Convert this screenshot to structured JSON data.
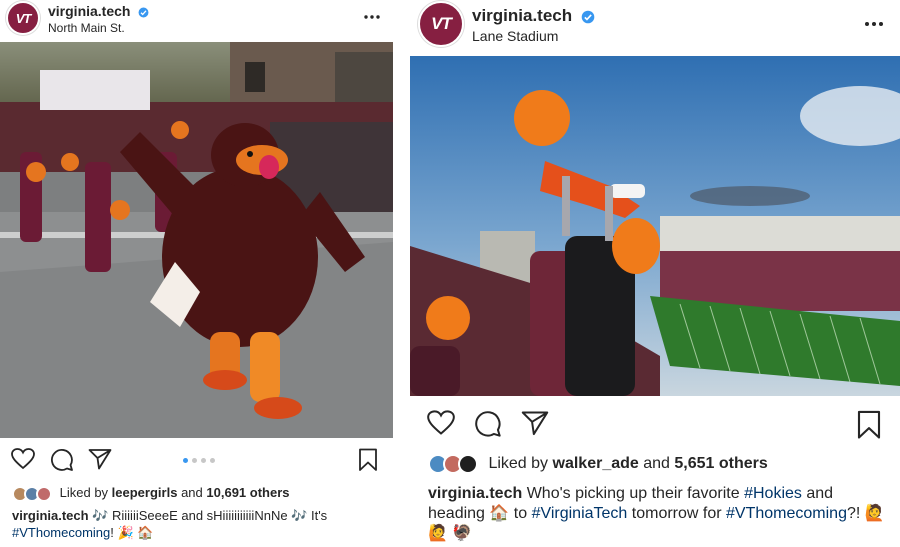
{
  "left_post": {
    "username": "virginia.tech",
    "location": "North Main St.",
    "avatar_text": "VT",
    "carousel": {
      "count": 4,
      "active": 1
    },
    "liked_by_prefix": "Liked by",
    "liked_by_user": "leepergirls",
    "liked_by_and": "and",
    "liked_by_others": "10,691 others",
    "caption_user": "virginia.tech",
    "caption_text": "🎶 RiiiiiiSeeeE and sHiiiiiiiiiiiNnNe 🎶 It's",
    "caption_hashtag": "#VThomecoming",
    "caption_tail": "! 🎉 🏠"
  },
  "right_post": {
    "username": "virginia.tech",
    "location": "Lane Stadium",
    "avatar_text": "VT",
    "liked_by_prefix": "Liked by",
    "liked_by_user": "walker_ade",
    "liked_by_and": "and",
    "liked_by_others": "5,651 others",
    "caption_user": "virginia.tech",
    "caption_text_1": "Who's picking up their favorite",
    "caption_hashtag_1": "#Hokies",
    "caption_text_2": "and heading 🏠 to",
    "caption_hashtag_2": "#VirginiaTech",
    "caption_text_3": "tomorrow for",
    "caption_hashtag_3": "#VThomecoming",
    "caption_tail": "?! 🙋 🙋 🦃"
  },
  "colors": {
    "maroon": "#861f41",
    "orange": "#e5751f",
    "verified": "#3897f0",
    "hashtag": "#003569"
  },
  "icons": [
    "verified-icon",
    "more-icon",
    "heart-icon",
    "comment-icon",
    "share-icon",
    "bookmark-icon"
  ]
}
